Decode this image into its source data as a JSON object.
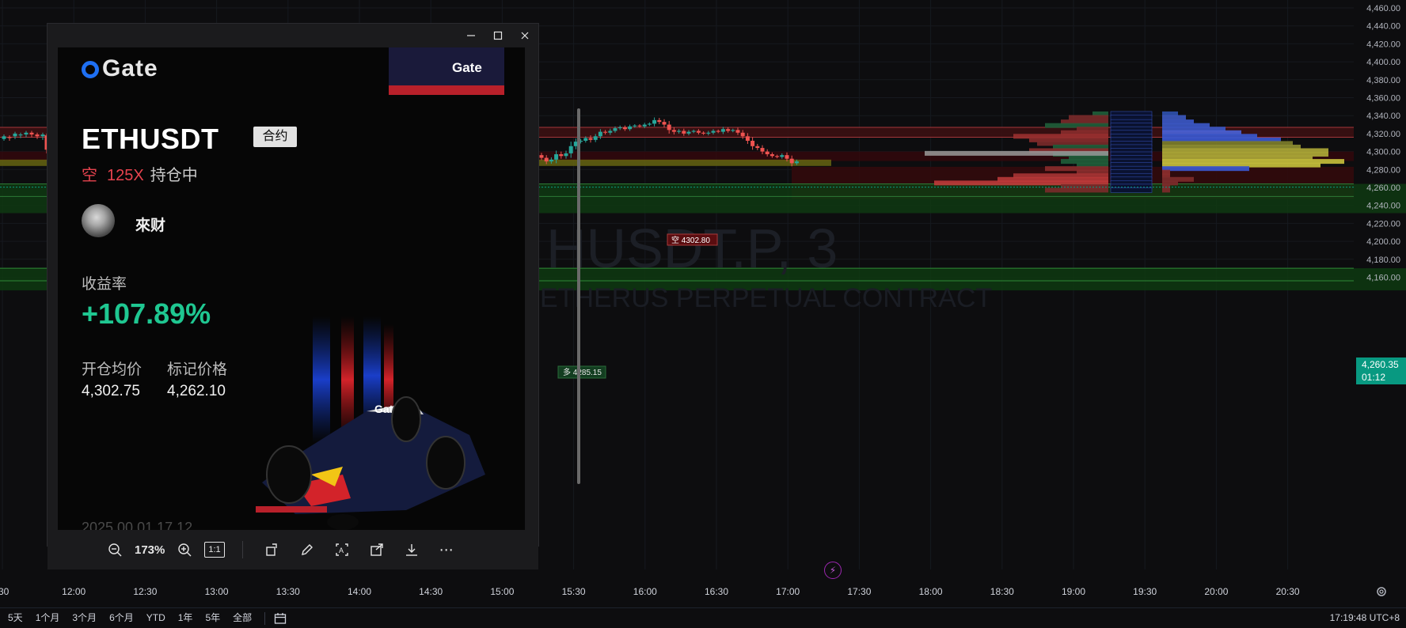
{
  "price_axis": {
    "labels": [
      "4,460.00",
      "4,440.00",
      "4,420.00",
      "4,400.00",
      "4,380.00",
      "4,360.00",
      "4,340.00",
      "4,320.00",
      "4,300.00",
      "4,280.00",
      "4,260.00",
      "4,240.00",
      "4,220.00",
      "4,200.00",
      "4,180.00",
      "4,160.00"
    ],
    "current_price": "4,260.35",
    "countdown": "01:12",
    "current_color": "#089981"
  },
  "time_axis": {
    "labels": [
      ":30",
      "12:00",
      "12:30",
      "13:00",
      "13:30",
      "14:00",
      "14:30",
      "15:00",
      "15:30",
      "16:00",
      "16:30",
      "17:00",
      "17:30",
      "18:00",
      "18:30",
      "19:00",
      "19:30",
      "20:00",
      "20:30"
    ]
  },
  "watermark": {
    "symbol": "HUSDT.P, 3",
    "subtitle": "ETHERUS PERPETUAL CONTRACT"
  },
  "orders": {
    "short_label": "空 4302.80",
    "long_label": "多 4285.15"
  },
  "chart_data": {
    "type": "candlestick",
    "x_range": [
      "11:30",
      "20:50"
    ],
    "ylim": [
      4150,
      4465
    ],
    "candles_visible_range": [
      "15:15",
      "17:20"
    ],
    "last_price": 4260.35,
    "horizontal_levels": [
      4324,
      4292,
      4262,
      4164
    ],
    "colors": {
      "up": "#26a69a",
      "down": "#ef5350"
    }
  },
  "bottom_bar": {
    "ranges": [
      "5天",
      "1个月",
      "3个月",
      "6个月",
      "YTD",
      "1年",
      "5年",
      "全部"
    ],
    "clock": "17:19:48 UTC+8"
  },
  "viewer": {
    "zoom": "173%",
    "actual_size": "1:1"
  },
  "card": {
    "brand": "Gate",
    "flag_brand": "Gate",
    "symbol": "ETHUSDT",
    "tag": "合约",
    "direction": "空",
    "leverage": "125X",
    "status": "持仓中",
    "user": "來财",
    "roi_label": "收益率",
    "roi": "+107.89%",
    "entry_label": "开仓均价",
    "mark_label": "标记价格",
    "entry_price": "4,302.75",
    "mark_price": "4,262.10",
    "car_brand": "Gate",
    "timestamp_partial": "2025 00 01 17 12"
  },
  "colors": {
    "up": "#26a69a",
    "down": "#ef5350",
    "roi": "#1fc791",
    "short": "#e7434e"
  }
}
